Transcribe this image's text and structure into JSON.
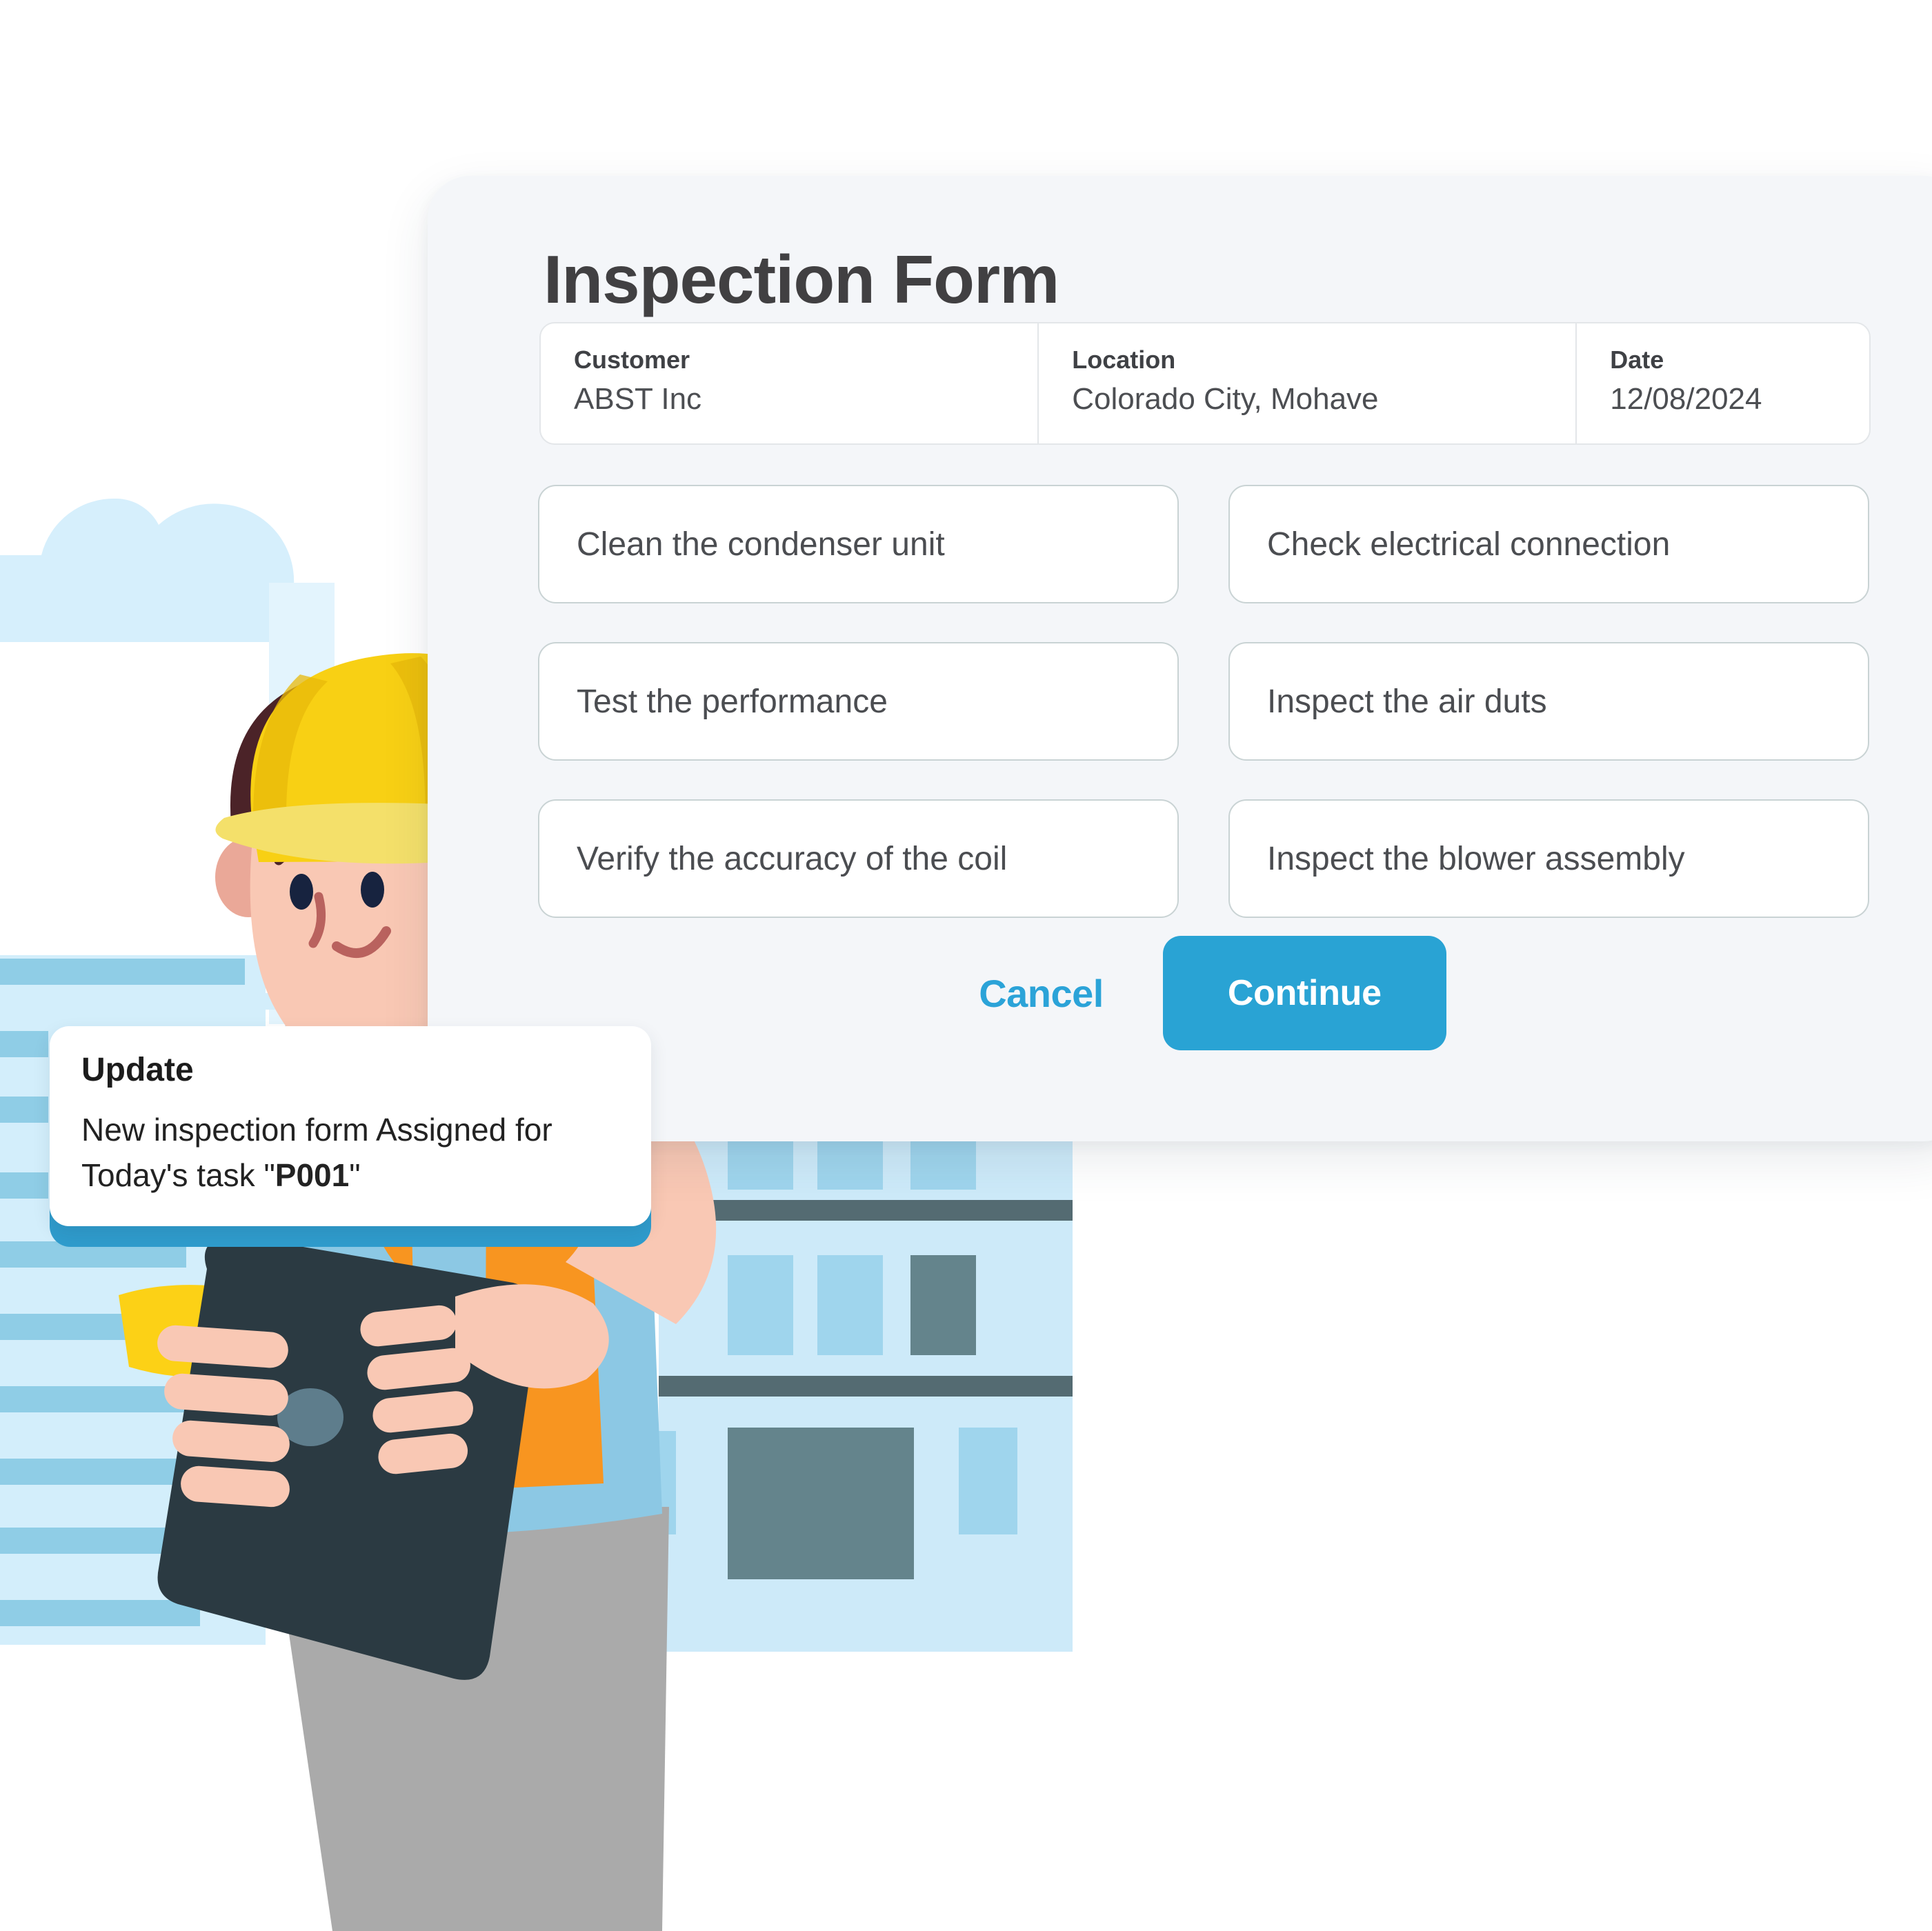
{
  "form": {
    "title": "Inspection Form",
    "info": [
      {
        "label": "Customer",
        "value": "ABST Inc"
      },
      {
        "label": "Location",
        "value": "Colorado City, Mohave"
      },
      {
        "label": "Date",
        "value": "12/08/2024"
      }
    ],
    "checklist": [
      "Clean the condenser unit",
      "Check electrical connection",
      "Test the performance",
      "Inspect the air duts",
      "Verify the accuracy of the coil",
      "Inspect the blower assembly"
    ],
    "buttons": {
      "cancel": "Cancel",
      "continue": "Continue"
    }
  },
  "notification": {
    "title": "Update",
    "line1": "New inspection form Assigned",
    "line2_prefix": "for Today's  task \"",
    "task_id": "P001",
    "line2_suffix": "\""
  },
  "colors": {
    "accent_blue": "#29a3d4",
    "card_bg": "#f4f6f9",
    "text_dark": "#414042",
    "box_border": "#c9d3d4",
    "helmet_yellow": "#f8d014",
    "vest_orange": "#f89520",
    "shirt_blue": "#8cc8e4",
    "pants_gray": "#aaaaaa",
    "tablet_dark": "#2b3a42",
    "building_light": "#cdeaf9",
    "building_window": "#9fd5ed",
    "building_band": "#546b72",
    "skin": "#f9c8b4",
    "hair_brown": "#4b2328"
  }
}
